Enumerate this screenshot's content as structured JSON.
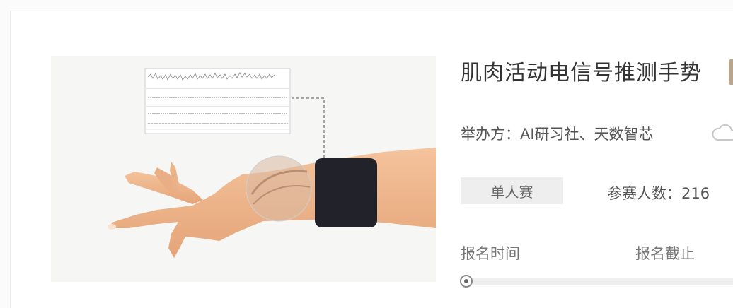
{
  "competition": {
    "title": "肌肉活动电信号推测手势",
    "organizer_label": "举办方：",
    "organizers": "AI研习社、天数智芯",
    "mode": "单人赛",
    "participants_label": "参赛人数：",
    "participants_count": "216",
    "registration_time_label": "报名时间",
    "registration_deadline_label": "报名截止",
    "progress_fraction": 0.0
  },
  "icons": {
    "cloud": "cloud-icon"
  },
  "colors": {
    "tag": "#b9a48c",
    "badge_bg": "#eeeeee",
    "armband": "#22222b",
    "skin": "#f0b98f"
  }
}
